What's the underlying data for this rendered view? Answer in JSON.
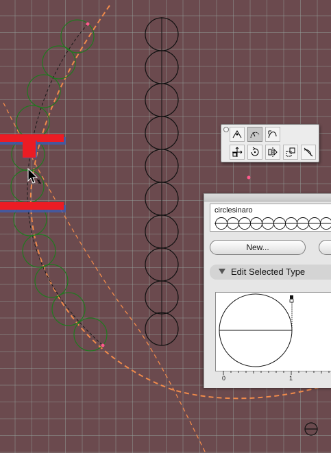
{
  "canvas": {
    "background": "#6b4a4e",
    "grid_color": "#96a5a0",
    "guide_color": "#f08a4b",
    "path_color": "#1a1a1a",
    "circle_green": "#1f7a1f",
    "circle_black": "#000000",
    "selection_red": "#ec1c24",
    "selection_blue": "#3d5bb0",
    "anchor_pink": "#ff5a8c"
  },
  "toolbox": {
    "tools": [
      {
        "icon": "add-point-tool-icon",
        "active": false
      },
      {
        "icon": "arc-tool-icon",
        "active": true
      },
      {
        "icon": "curve-tool-icon",
        "active": false
      },
      {
        "icon": "move-tool-icon",
        "active": false
      },
      {
        "icon": "rotate-tool-icon",
        "active": false
      },
      {
        "icon": "reflect-tool-icon",
        "active": false
      },
      {
        "icon": "scale-tool-icon",
        "active": false
      },
      {
        "icon": "pen-tool-icon",
        "active": false
      }
    ]
  },
  "panel": {
    "type_name": "circlesinaro",
    "new_button_label": "New...",
    "section_title": "Edit Selected Type",
    "ruler_labels": [
      "0",
      "1"
    ]
  }
}
